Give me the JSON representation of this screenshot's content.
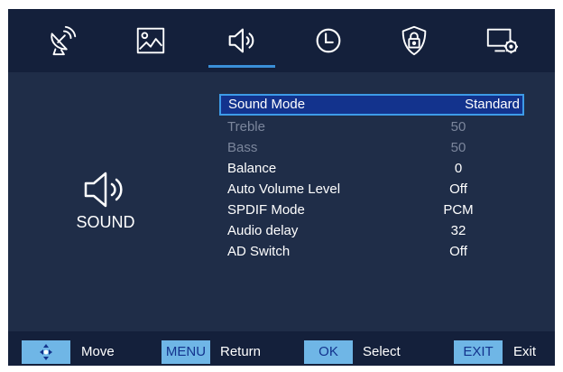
{
  "tabs": [
    {
      "icon": "satellite-dish-icon"
    },
    {
      "icon": "picture-icon"
    },
    {
      "icon": "speaker-icon",
      "selected": true
    },
    {
      "icon": "clock-icon"
    },
    {
      "icon": "lock-shield-icon"
    },
    {
      "icon": "monitor-settings-icon"
    }
  ],
  "side": {
    "icon": "speaker-icon",
    "label": "SOUND"
  },
  "menu": [
    {
      "label": "Sound Mode",
      "value": "Standard",
      "state": "selected"
    },
    {
      "label": "Treble",
      "value": "50",
      "state": "disabled"
    },
    {
      "label": "Bass",
      "value": "50",
      "state": "disabled"
    },
    {
      "label": "Balance",
      "value": "0",
      "state": "normal"
    },
    {
      "label": "Auto Volume Level",
      "value": "Off",
      "state": "normal"
    },
    {
      "label": "SPDIF Mode",
      "value": "PCM",
      "state": "normal"
    },
    {
      "label": "Audio delay",
      "value": "32",
      "state": "normal"
    },
    {
      "label": "AD Switch",
      "value": "Off",
      "state": "normal"
    }
  ],
  "hints": [
    {
      "key_icon": "arrows-icon",
      "text": "Move"
    },
    {
      "key": "MENU",
      "text": "Return"
    },
    {
      "key": "OK",
      "text": "Select"
    },
    {
      "key": "EXIT",
      "text": "Exit"
    }
  ],
  "colors": {
    "background": "#1f2d48",
    "bars": "#14203b",
    "highlight": "#13338d",
    "highlight_border": "#3d9be8",
    "key_bg": "#6fb6e6",
    "disabled_text": "#7b869c"
  }
}
